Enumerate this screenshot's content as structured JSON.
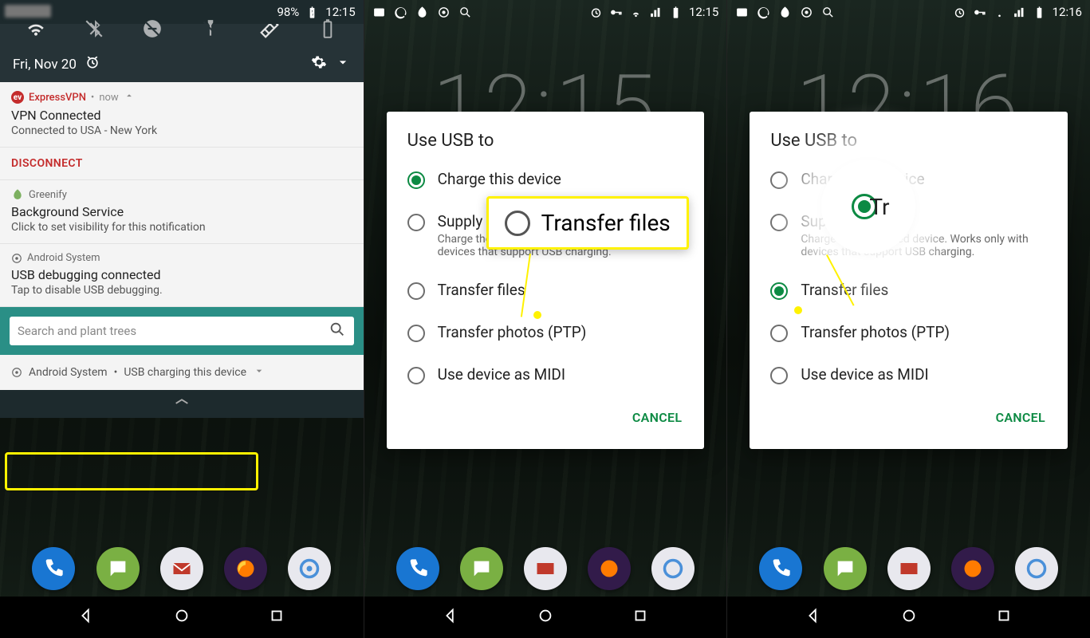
{
  "phones": {
    "p1": {
      "status": {
        "battery_pct": "98%",
        "time": "12:15"
      },
      "date": "Fri, Nov 20",
      "notifs": {
        "vpn": {
          "app": "ExpressVPN",
          "time": "now",
          "title": "VPN Connected",
          "sub": "Connected to USA - New York",
          "action": "DISCONNECT"
        },
        "greenify": {
          "app": "Greenify",
          "title": "Background Service",
          "sub": "Click to set visibility for this notification"
        },
        "usb_debug": {
          "app": "Android System",
          "title": "USB debugging connected",
          "sub": "Tap to disable USB debugging."
        },
        "usb_charge": {
          "app": "Android System",
          "text": "USB charging this device"
        }
      },
      "search": {
        "placeholder": "Search and plant trees"
      }
    },
    "p2": {
      "status": {
        "time": "12:15"
      },
      "bg_clock": "12:15",
      "dialog_title": "Use USB to",
      "options": [
        {
          "label": "Charge this device",
          "checked": true
        },
        {
          "label": "Supply power",
          "desc": "Charge the connected device. Works only with devices that support USB charging.",
          "checked": false
        },
        {
          "label": "Transfer files",
          "checked": false
        },
        {
          "label": "Transfer photos (PTP)",
          "checked": false
        },
        {
          "label": "Use device as MIDI",
          "checked": false
        }
      ],
      "cancel": "CANCEL",
      "callout_label": "Transfer files"
    },
    "p3": {
      "status": {
        "time": "12:16"
      },
      "bg_clock": "12:16",
      "dialog_title": "Use USB to",
      "options": [
        {
          "label": "Charge this device",
          "checked": false
        },
        {
          "label": "Supply power",
          "desc": "Charge the connected device. Works only with devices that support USB charging.",
          "checked": false
        },
        {
          "label": "Transfer files",
          "checked": true
        },
        {
          "label": "Transfer photos (PTP)",
          "checked": false
        },
        {
          "label": "Use device as MIDI",
          "checked": false
        }
      ],
      "cancel": "CANCEL",
      "callout_label": "Tr"
    }
  }
}
